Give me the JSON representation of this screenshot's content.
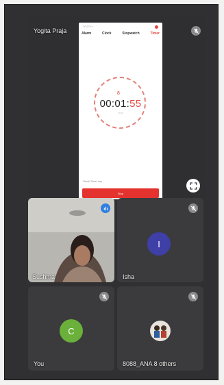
{
  "presenter": {
    "name": "Yogita Praja",
    "phone": {
      "status_text": "10:27 ▪ ▪",
      "tabs": [
        {
          "label": "Alarm",
          "active": false
        },
        {
          "label": "Clock",
          "active": false
        },
        {
          "label": "Stopwatch",
          "active": false
        },
        {
          "label": "Timer",
          "active": true
        }
      ],
      "timer_mark": "8",
      "time_main": "00:01:",
      "time_seconds": "55",
      "small_label": "00:05",
      "sound_label": "Stock Timer tap",
      "button_label": "Stop"
    }
  },
  "participants": [
    {
      "name": "Sushma",
      "has_video": true
    },
    {
      "name": "Isha",
      "initial": "I",
      "avatar_color": "#3f3fa8"
    },
    {
      "name": "You",
      "initial": "C",
      "avatar_color": "#6ab03a"
    },
    {
      "name": "8088_ANA",
      "extra": "8 others"
    }
  ],
  "colors": {
    "accent": "#e0483f",
    "tile": "#3b3b3e",
    "background": "#303032"
  }
}
